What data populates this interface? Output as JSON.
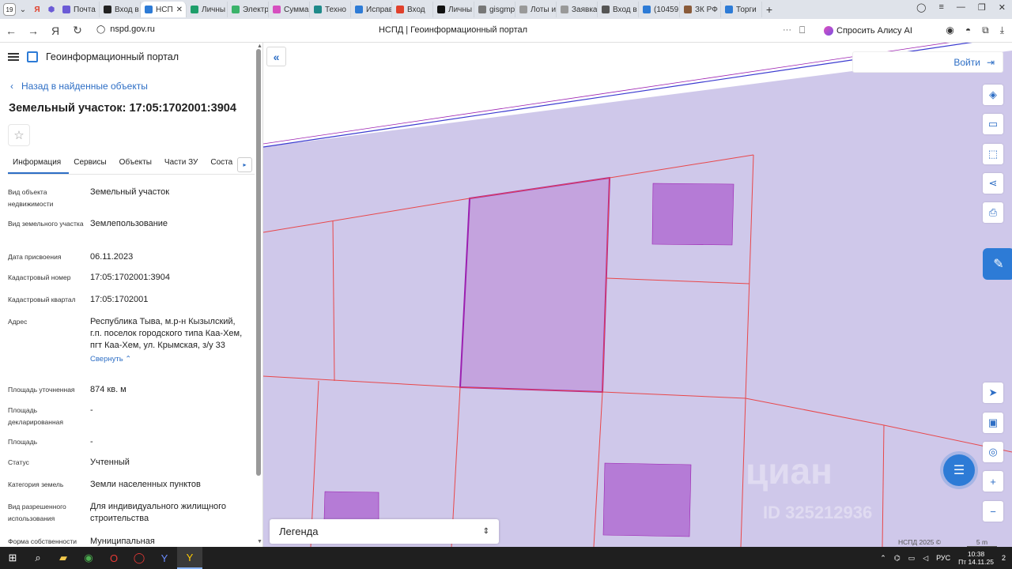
{
  "browser": {
    "tab_count": "19",
    "tabs": [
      {
        "label": "Почта",
        "color": "#6b5bd6"
      },
      {
        "label": "Вход в",
        "color": "#222"
      },
      {
        "label": "НСП",
        "color": "#2d7bd6",
        "active": true
      },
      {
        "label": "Личны",
        "color": "#1e9e6a"
      },
      {
        "label": "Электр",
        "color": "#3bb36a"
      },
      {
        "label": "Сумма",
        "color": "#d64fbf"
      },
      {
        "label": "Техно",
        "color": "#1f8a8a"
      },
      {
        "label": "Исправ",
        "color": "#2d7bd6"
      },
      {
        "label": "Вход",
        "color": "#e0402b"
      },
      {
        "label": "Личны",
        "color": "#111"
      },
      {
        "label": "gisgmp",
        "color": "#777"
      },
      {
        "label": "Лоты и",
        "color": "#999"
      },
      {
        "label": "Заявка",
        "color": "#999"
      },
      {
        "label": "Вход в",
        "color": "#555"
      },
      {
        "label": "(10459",
        "color": "#2d7bd6"
      },
      {
        "label": "ЗК РФ",
        "color": "#8a5b3a"
      },
      {
        "label": "Торги",
        "color": "#2d7bd6"
      }
    ],
    "url": "nspd.gov.ru",
    "page_title": "НСПД | Геоинформационный портал",
    "alice_label": "Спросить Алису AI"
  },
  "panel": {
    "portal_title": "Геоинформационный портал",
    "back_label": "Назад в найденные объекты",
    "object_title": "Земельный участок: 17:05:1702001:3904",
    "tabs": [
      "Информация",
      "Сервисы",
      "Объекты",
      "Части ЗУ",
      "Соста"
    ],
    "properties": [
      {
        "key": "Вид объекта недвижимости",
        "value": "Земельный участок"
      },
      {
        "key": "Вид земельного участка",
        "value": "Землепользование"
      },
      {
        "key": "Дата присвоения",
        "value": "06.11.2023"
      },
      {
        "key": "Кадастровый номер",
        "value": "17:05:1702001:3904"
      },
      {
        "key": "Кадастровый квартал",
        "value": "17:05:1702001"
      },
      {
        "key": "Адрес",
        "value": "Республика Тыва, м.р-н Кызылский, г.п. поселок городского типа Каа-Хем, пгт Каа-Хем, ул. Крымская, з/у 33"
      },
      {
        "key": "Площадь уточненная",
        "value": "874 кв. м"
      },
      {
        "key": "Площадь декларированная",
        "value": "-"
      },
      {
        "key": "Площадь",
        "value": "-"
      },
      {
        "key": "Статус",
        "value": "Учтенный"
      },
      {
        "key": "Категория земель",
        "value": "Земли населенных пунктов"
      },
      {
        "key": "Вид разрешенного использования",
        "value": "Для индивидуального жилищного строительства"
      },
      {
        "key": "Форма собственности",
        "value": "Муниципальная"
      }
    ],
    "collapse_label": "Свернуть"
  },
  "map": {
    "login_label": "Войти",
    "legend_label": "Легенда",
    "copyright": "НСПД 2025 ©",
    "scale": "5 m",
    "watermark": "циан",
    "watermark_id": "ID 325212936",
    "colors": {
      "zone": "#cfc8ea",
      "parcel_selected": "#c4a3de",
      "building": "#b57bd6",
      "line_red": "#e8474a",
      "line_purple": "#9b1fb0"
    }
  },
  "taskbar": {
    "lang": "РУС",
    "time": "10:38",
    "date": "Пт 14.11.25",
    "notifications": "2"
  }
}
